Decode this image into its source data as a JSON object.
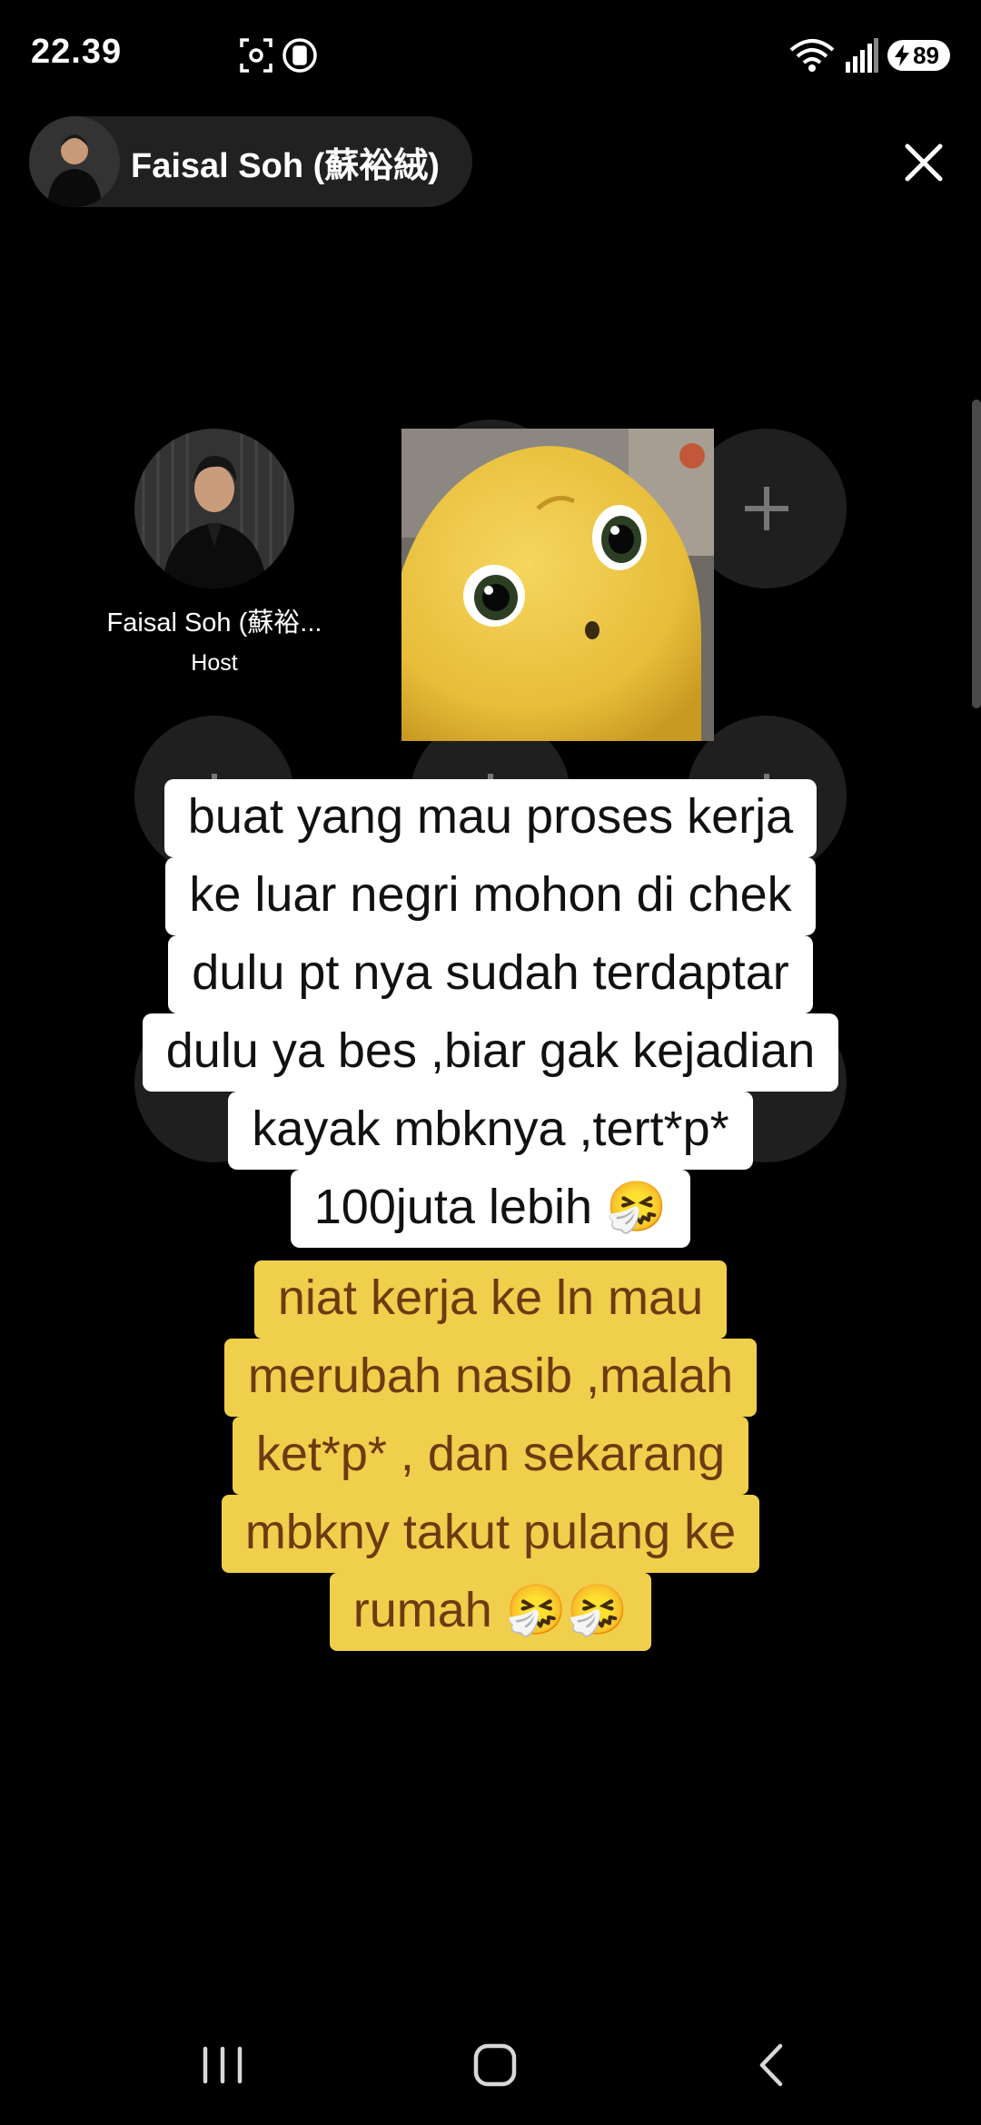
{
  "status_bar": {
    "time": "22.39",
    "battery_level": "89",
    "icons": [
      "screenshot-icon",
      "record-icon",
      "wifi-icon",
      "signal-icon",
      "battery-icon"
    ]
  },
  "header": {
    "host_name": "Faisal Soh (蘇裕絨)",
    "close_icon": "close-icon"
  },
  "seats": {
    "host": {
      "name": "Faisal Soh (蘇裕...",
      "role": "Host"
    },
    "empty_seat_icon": "plus-icon"
  },
  "captions": {
    "white_lines": [
      "buat yang mau proses kerja",
      "ke luar negri mohon di chek",
      "dulu pt nya sudah terdaptar",
      "dulu ya bes ,biar gak kejadian",
      "kayak mbknya ,tert*p*",
      "100juta lebih 🤧"
    ],
    "yellow_lines": [
      "niat kerja ke ln mau",
      "merubah nasib ,malah",
      "ket*p* , dan sekarang",
      "mbkny takut pulang ke",
      "rumah 🤧🤧"
    ]
  },
  "nav_bar": {
    "icons": [
      "recent-apps-icon",
      "home-icon",
      "back-icon"
    ]
  },
  "colors": {
    "background": "#000000",
    "caption_white_bg": "#ffffff",
    "caption_yellow_bg": "#f0cf4c",
    "caption_yellow_text": "#6e3a10"
  }
}
